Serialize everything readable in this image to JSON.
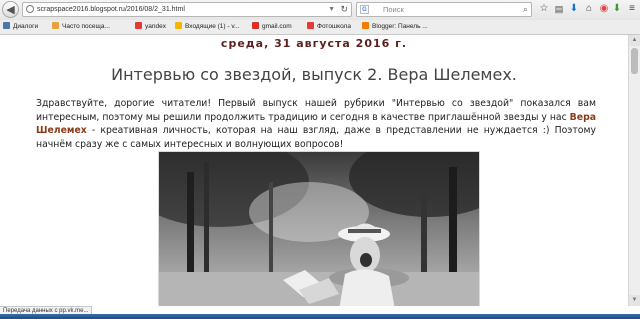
{
  "toolbar": {
    "back_glyph": "◀",
    "url": "scrapspace2016.blogspot.ru/2016/08/2_31.html",
    "search_placeholder": "Поиск",
    "search_engine_glyph": "G"
  },
  "bookmarks": [
    {
      "label": "Диалоги",
      "icon": "vk-icon",
      "color": "#4a76a8"
    },
    {
      "label": "Часто посеща...",
      "icon": "star-icon",
      "color": "#e6a23c"
    },
    {
      "label": "yandex",
      "icon": "yandex-icon",
      "color": "#e53935"
    },
    {
      "label": "Входящие (1) - v...",
      "icon": "yandex-mail-icon",
      "color": "#f4b400"
    },
    {
      "label": "gmail.com",
      "icon": "gmail-icon",
      "color": "#d93025"
    },
    {
      "label": "Фотошкола",
      "icon": "photoschool-icon",
      "color": "#e53935"
    },
    {
      "label": "Blogger: Панель ...",
      "icon": "blogger-icon",
      "color": "#f57c00"
    }
  ],
  "post": {
    "date": "среда, 31 августа 2016 г.",
    "title": "Интервью со звездой, выпуск 2. Вера Шелемех.",
    "body_before": "Здравствуйте, дорогие читатели! Первый выпуск нашей рубрики \"Интервью со звездой\" показался вам интересным, поэтому мы решили продолжить традицию и сегодня в качестве приглашённой звезды у нас ",
    "guest_name": "Вера Шелемех",
    "body_after": " - креативная личность, которая на наш взгляд, даже в представлении не нуждается :) Поэтому начнём сразу же с самых интересных и волнующих вопросов!"
  },
  "status_text": "Передача данных с pp.vk.me..."
}
